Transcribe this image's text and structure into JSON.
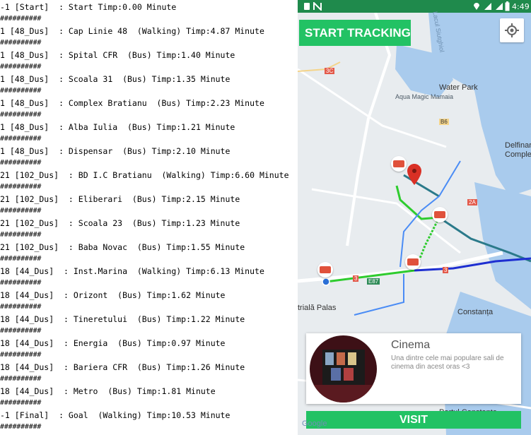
{
  "console": {
    "separator": "##########",
    "lines": [
      "-1 [Start]  : Start Timp:0.00 Minute",
      "1 [48_Dus]  : Cap Linie 48  (Walking) Timp:4.87 Minute",
      "1 [48_Dus]  : Spital CFR  (Bus) Timp:1.40 Minute",
      "1 [48_Dus]  : Scoala 31  (Bus) Timp:1.35 Minute",
      "1 [48_Dus]  : Complex Bratianu  (Bus) Timp:2.23 Minute",
      "1 [48_Dus]  : Alba Iulia  (Bus) Timp:1.21 Minute",
      "1 [48_Dus]  : Dispensar  (Bus) Timp:2.10 Minute",
      "21 [102_Dus]  : BD I.C Bratianu  (Walking) Timp:6.60 Minute",
      "21 [102_Dus]  : Eliberari  (Bus) Timp:2.15 Minute",
      "21 [102_Dus]  : Scoala 23  (Bus) Timp:1.23 Minute",
      "21 [102_Dus]  : Baba Novac  (Bus) Timp:1.55 Minute",
      "18 [44_Dus]  : Inst.Marina  (Walking) Timp:6.13 Minute",
      "18 [44_Dus]  : Orizont  (Bus) Timp:1.62 Minute",
      "18 [44_Dus]  : Tineretului  (Bus) Timp:1.22 Minute",
      "18 [44_Dus]  : Energia  (Bus) Timp:0.97 Minute",
      "18 [44_Dus]  : Bariera CFR  (Bus) Timp:1.26 Minute",
      "18 [44_Dus]  : Metro  (Bus) Timp:1.81 Minute",
      "-1 [Final]  : Goal  (Walking) Timp:10.53 Minute"
    ]
  },
  "status_bar": {
    "time": "4:49"
  },
  "app": {
    "start_tracking_label": "START TRACKING",
    "visit_label": "VISIT",
    "google_label": "Google"
  },
  "map_labels": {
    "water_park": "Water Park",
    "aqua_magic": "Aqua Magic Mamaia",
    "delfinariu": "Delfinar",
    "delfinariu2": "Comple",
    "constanta": "Constanța",
    "palas": "trială Palas",
    "portul": "Portul Constanța",
    "road_3c": "3C",
    "road_b6": "B6",
    "road_2a": "2A",
    "road_3": "3",
    "road_e87": "E87",
    "lacul": "Lacul Siutghiol"
  },
  "card": {
    "title": "Cinema",
    "description": "Una dintre cele mai populare sali de cinema din acest oras <3"
  },
  "colors": {
    "accent_green": "#22c264",
    "status_green": "#1f8a4c",
    "route_blue": "#1e2fd1",
    "route_green": "#2ecc2e",
    "route_teal": "#2b7a8a"
  }
}
